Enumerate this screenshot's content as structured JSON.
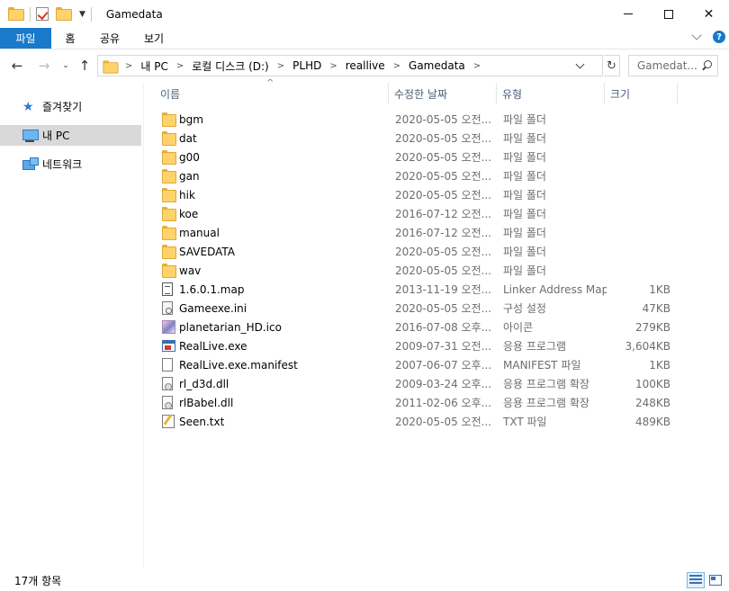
{
  "window": {
    "title": "Gamedata"
  },
  "ribbon": {
    "tabs": [
      "파일",
      "홈",
      "공유",
      "보기"
    ]
  },
  "address": {
    "crumbs": [
      "내 PC",
      "로컬 디스크 (D:)",
      "PLHD",
      "reallive",
      "Gamedata"
    ]
  },
  "search": {
    "placeholder": "Gamedat..."
  },
  "nav": {
    "items": [
      {
        "label": "즐겨찾기",
        "icon": "star-icon"
      },
      {
        "label": "내 PC",
        "icon": "pc-icon"
      },
      {
        "label": "네트워크",
        "icon": "network-icon"
      }
    ]
  },
  "columns": {
    "name": "이름",
    "date": "수정한 날짜",
    "type": "유형",
    "size": "크기"
  },
  "files": [
    {
      "icon": "folder",
      "name": "bgm",
      "date": "2020-05-05 오전...",
      "type": "파일 폴더",
      "size": ""
    },
    {
      "icon": "folder",
      "name": "dat",
      "date": "2020-05-05 오전...",
      "type": "파일 폴더",
      "size": ""
    },
    {
      "icon": "folder",
      "name": "g00",
      "date": "2020-05-05 오전...",
      "type": "파일 폴더",
      "size": ""
    },
    {
      "icon": "folder",
      "name": "gan",
      "date": "2020-05-05 오전...",
      "type": "파일 폴더",
      "size": ""
    },
    {
      "icon": "folder",
      "name": "hik",
      "date": "2020-05-05 오전...",
      "type": "파일 폴더",
      "size": ""
    },
    {
      "icon": "folder",
      "name": "koe",
      "date": "2016-07-12 오전...",
      "type": "파일 폴더",
      "size": ""
    },
    {
      "icon": "folder",
      "name": "manual",
      "date": "2016-07-12 오전...",
      "type": "파일 폴더",
      "size": ""
    },
    {
      "icon": "folder",
      "name": "SAVEDATA",
      "date": "2020-05-05 오전...",
      "type": "파일 폴더",
      "size": ""
    },
    {
      "icon": "folder",
      "name": "wav",
      "date": "2020-05-05 오전...",
      "type": "파일 폴더",
      "size": ""
    },
    {
      "icon": "doc-lines",
      "name": "1.6.0.1.map",
      "date": "2013-11-19 오전...",
      "type": "Linker Address Map",
      "size": "1KB"
    },
    {
      "icon": "ini",
      "name": "Gameexe.ini",
      "date": "2020-05-05 오전...",
      "type": "구성 설정",
      "size": "47KB"
    },
    {
      "icon": "img",
      "name": "planetarian_HD.ico",
      "date": "2016-07-08 오후...",
      "type": "아이콘",
      "size": "279KB"
    },
    {
      "icon": "exe",
      "name": "RealLive.exe",
      "date": "2009-07-31 오전...",
      "type": "응용 프로그램",
      "size": "3,604KB"
    },
    {
      "icon": "doc",
      "name": "RealLive.exe.manifest",
      "date": "2007-06-07 오후...",
      "type": "MANIFEST 파일",
      "size": "1KB"
    },
    {
      "icon": "dll",
      "name": "rl_d3d.dll",
      "date": "2009-03-24 오후...",
      "type": "응용 프로그램 확장",
      "size": "100KB"
    },
    {
      "icon": "dll",
      "name": "rlBabel.dll",
      "date": "2011-02-06 오후...",
      "type": "응용 프로그램 확장",
      "size": "248KB"
    },
    {
      "icon": "txt",
      "name": "Seen.txt",
      "date": "2020-05-05 오전...",
      "type": "TXT 파일",
      "size": "489KB"
    }
  ],
  "status": {
    "count": "17개 항목"
  }
}
